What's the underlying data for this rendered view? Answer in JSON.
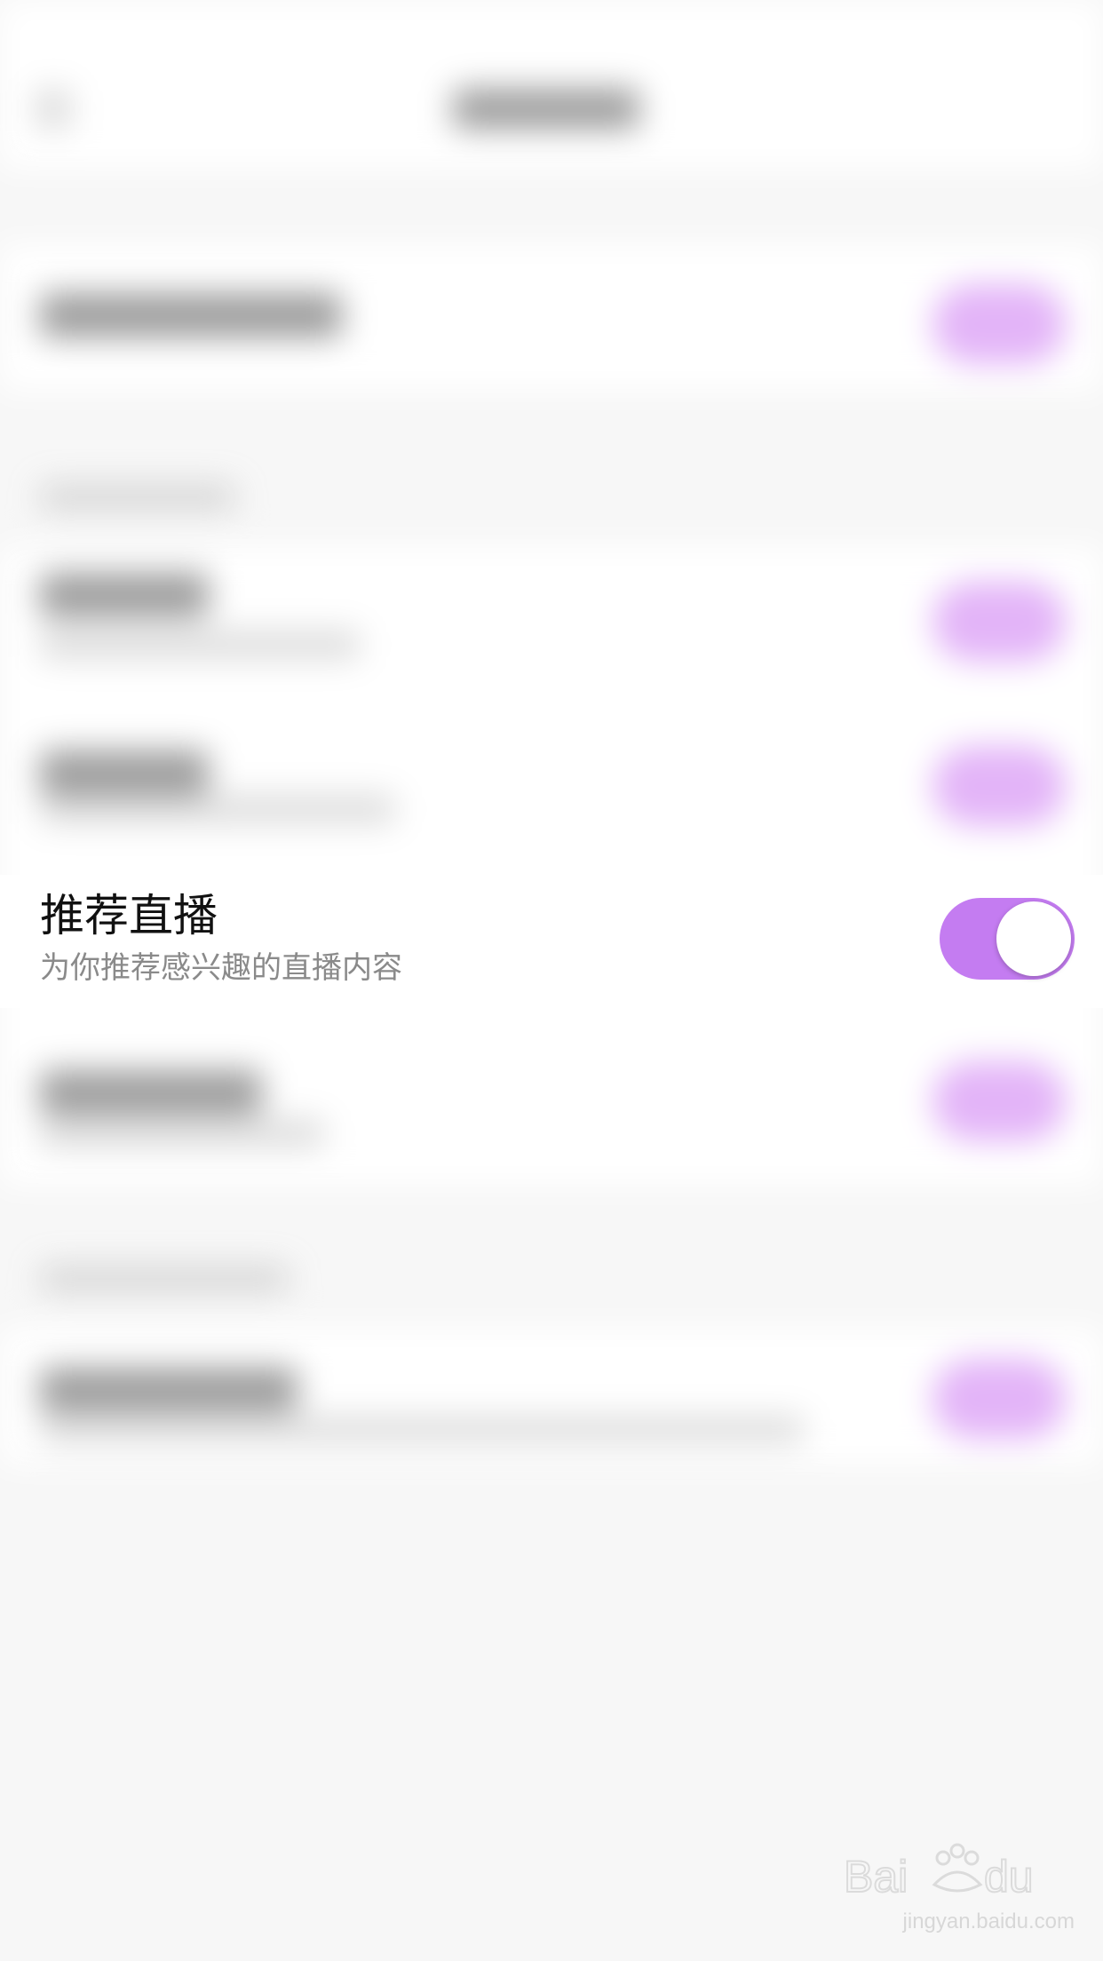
{
  "row": {
    "title": "推荐直播",
    "subtitle": "为你推荐感兴趣的直播内容",
    "toggle_on": true
  },
  "colors": {
    "accent": "#c47cf1",
    "background": "#f7f7f7",
    "title_text": "#111111",
    "subtitle_text": "#8a8a8a"
  },
  "watermark": {
    "logo": "Bai du 经验",
    "url": "jingyan.baidu.com"
  }
}
